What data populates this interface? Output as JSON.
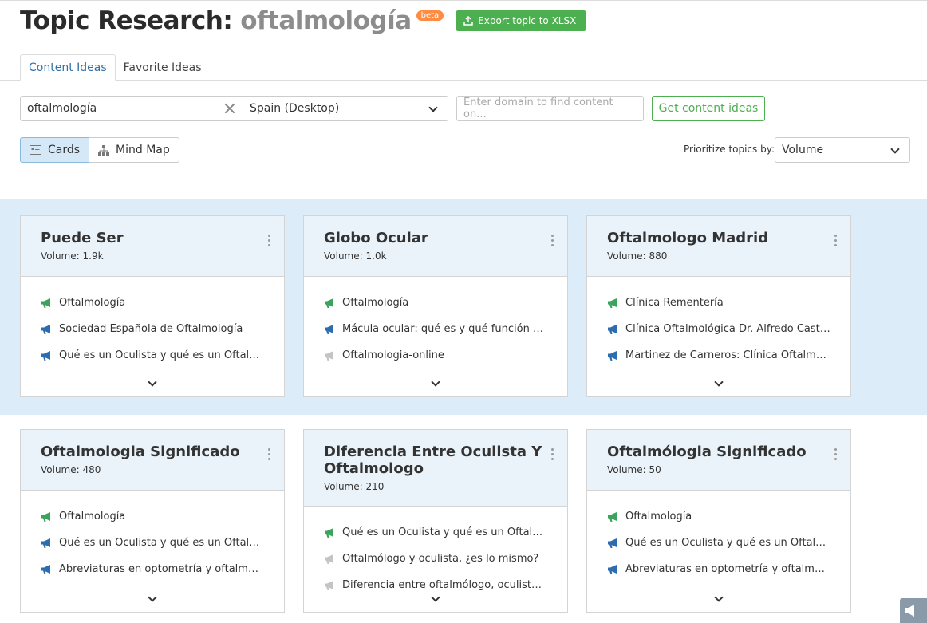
{
  "header": {
    "title": "Topic Research:",
    "topic": "oftalmología",
    "beta": "beta",
    "export_label": "Export topic to XLSX"
  },
  "tabs": [
    {
      "label": "Content Ideas",
      "active": true
    },
    {
      "label": "Favorite Ideas",
      "active": false
    }
  ],
  "controls": {
    "search_value": "oftalmología",
    "region_value": "Spain (Desktop)",
    "domain_placeholder": "Enter domain to find content on...",
    "get_ideas_label": "Get content ideas",
    "view_cards_label": "Cards",
    "view_mindmap_label": "Mind Map",
    "prioritize_label": "Prioritize topics by:",
    "prioritize_value": "Volume"
  },
  "colors": {
    "accent_green": "#4caf50",
    "icon_green": "#3aa35c",
    "icon_blue": "#2c6db0",
    "icon_gray": "#c4c4c4",
    "band": "#dcecf8",
    "card_head": "#eaf3fa"
  },
  "cards": [
    {
      "title": "Puede Ser",
      "volume": "Volume: 1.9k",
      "items": [
        {
          "icon": "megaphone-green-icon",
          "text": "Oftalmología"
        },
        {
          "icon": "megaphone-blue-icon",
          "text": "Sociedad Española de Oftalmología"
        },
        {
          "icon": "megaphone-blue-icon",
          "text": "Qué es un Oculista y qué es un Oftalmólogo?"
        }
      ]
    },
    {
      "title": "Globo Ocular",
      "volume": "Volume: 1.0k",
      "items": [
        {
          "icon": "megaphone-green-icon",
          "text": "Oftalmología"
        },
        {
          "icon": "megaphone-blue-icon",
          "text": "Mácula ocular: qué es y qué función desempeña"
        },
        {
          "icon": "megaphone-gray-icon",
          "text": "Oftalmologia-online"
        }
      ]
    },
    {
      "title": "Oftalmologo Madrid",
      "volume": "Volume: 880",
      "items": [
        {
          "icon": "megaphone-green-icon",
          "text": "Clínica Rementería"
        },
        {
          "icon": "megaphone-blue-icon",
          "text": "Clínica Oftalmológica Dr. Alfredo Castillo | Madrid"
        },
        {
          "icon": "megaphone-blue-icon",
          "text": "Martinez de Carneros: Clínica Oftalmológica"
        }
      ]
    },
    {
      "title": "Oftalmologia Significado",
      "volume": "Volume: 480",
      "items": [
        {
          "icon": "megaphone-green-icon",
          "text": "Oftalmología"
        },
        {
          "icon": "megaphone-blue-icon",
          "text": "Qué es un Oculista y qué es un Oftalmólogo?"
        },
        {
          "icon": "megaphone-blue-icon",
          "text": "Abreviaturas en optometría y oftalmología"
        }
      ]
    },
    {
      "title": "Diferencia Entre Oculista Y Oftalmologo",
      "volume": "Volume: 210",
      "items": [
        {
          "icon": "megaphone-green-icon",
          "text": "Qué es un Oculista y qué es un Oftalmólogo?"
        },
        {
          "icon": "megaphone-gray-icon",
          "text": "Oftalmólogo y oculista, ¿es lo mismo?"
        },
        {
          "icon": "megaphone-gray-icon",
          "text": "Diferencia entre oftalmólogo, oculista y optometrista"
        }
      ]
    },
    {
      "title": "Oftalmólogia Significado",
      "volume": "Volume: 50",
      "items": [
        {
          "icon": "megaphone-green-icon",
          "text": "Oftalmología"
        },
        {
          "icon": "megaphone-blue-icon",
          "text": "Qué es un Oculista y qué es un Oftalmólogo?"
        },
        {
          "icon": "megaphone-blue-icon",
          "text": "Abreviaturas en optometría y oftalmología"
        }
      ]
    }
  ]
}
